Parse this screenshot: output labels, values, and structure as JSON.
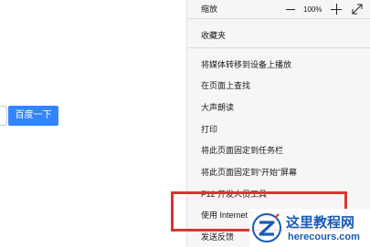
{
  "search": {
    "button_label": "百度一下"
  },
  "menu": {
    "zoom": {
      "label": "缩放",
      "value": "100%"
    },
    "items": [
      {
        "label": "收藏夹"
      },
      {
        "label": "将媒体转移到设备上播放"
      },
      {
        "label": "在页面上查找"
      },
      {
        "label": "大声朗读"
      },
      {
        "label": "打印"
      },
      {
        "label": "将此页面固定到任务栏"
      },
      {
        "label": "将此页面固定到“开始”屏幕"
      },
      {
        "label": "F12 开发人员工具"
      },
      {
        "label": "使用 Internet Explorer 打开"
      },
      {
        "label": "发送反馈"
      }
    ]
  },
  "watermark": {
    "title": "这里教程网",
    "url": "herecours.com"
  },
  "colors": {
    "accent_blue": "#3385ff",
    "highlight_red": "#d93532",
    "watermark_blue": "#1a5bb5"
  }
}
